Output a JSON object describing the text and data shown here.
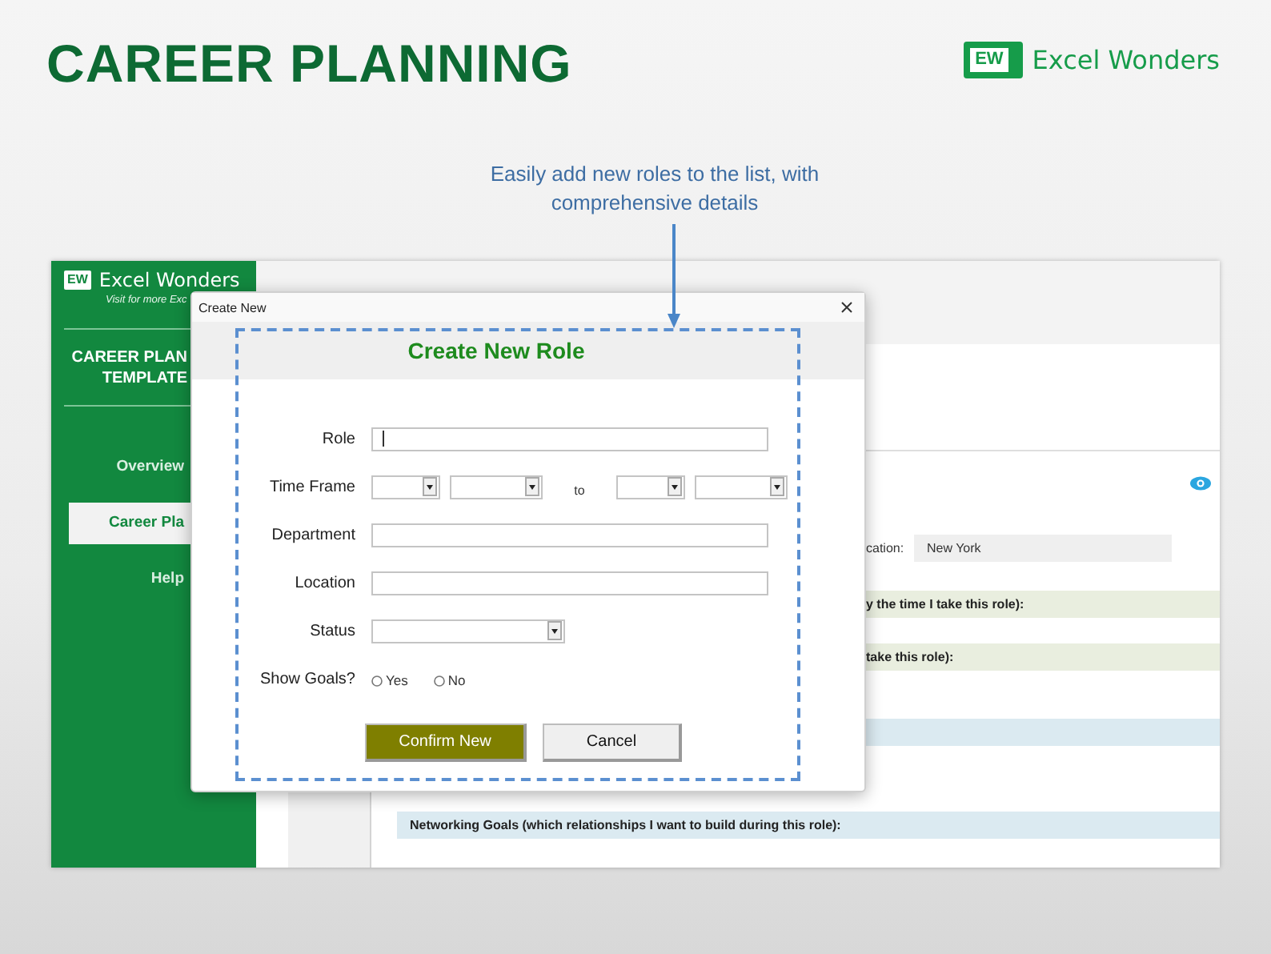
{
  "page_title": "CAREER PLANNING",
  "brand": {
    "mark": "EW",
    "name": "Excel Wonders"
  },
  "callout": "Easily add new roles to the list, with comprehensive details",
  "app": {
    "sidebar": {
      "mark": "EW",
      "name": "Excel Wonders",
      "tagline": "Visit for more Exc",
      "title_lines": [
        "CAREER PLAN",
        "TEMPLATE"
      ],
      "items": [
        {
          "label": "Overview",
          "selected": false
        },
        {
          "label": "Career Pla",
          "selected": true
        },
        {
          "label": "Help",
          "selected": false
        }
      ]
    },
    "main": {
      "location_label": "cation:",
      "location_value": "New York",
      "sections": [
        {
          "kind": "cut",
          "title": "y the time I take this role):",
          "color": "#e9eedf"
        },
        {
          "kind": "cut",
          "title": "take this role):",
          "color": "#e9eedf"
        },
        {
          "kind": "cut",
          "color": "#dbeaf1"
        },
        {
          "kind": "full",
          "title": "Networking Goals (which relationships I want to build during this role):",
          "color": "#dbeaf1"
        }
      ]
    }
  },
  "dialog": {
    "window_title": "Create New",
    "heading": "Create New Role",
    "fields": [
      {
        "kind": "text",
        "label": "Role",
        "focused": true
      },
      {
        "kind": "range",
        "label": "Time Frame",
        "separator": "to"
      },
      {
        "kind": "text",
        "label": "Department",
        "focused": false
      },
      {
        "kind": "text",
        "label": "Location",
        "focused": false
      },
      {
        "kind": "select",
        "label": "Status"
      },
      {
        "kind": "radio",
        "label": "Show Goals?",
        "options": [
          {
            "label": "Yes",
            "selected": false
          },
          {
            "label": "No",
            "selected": false
          }
        ]
      }
    ],
    "buttons": [
      {
        "label": "Confirm New",
        "primary": true
      },
      {
        "label": "Cancel",
        "primary": false
      }
    ]
  }
}
